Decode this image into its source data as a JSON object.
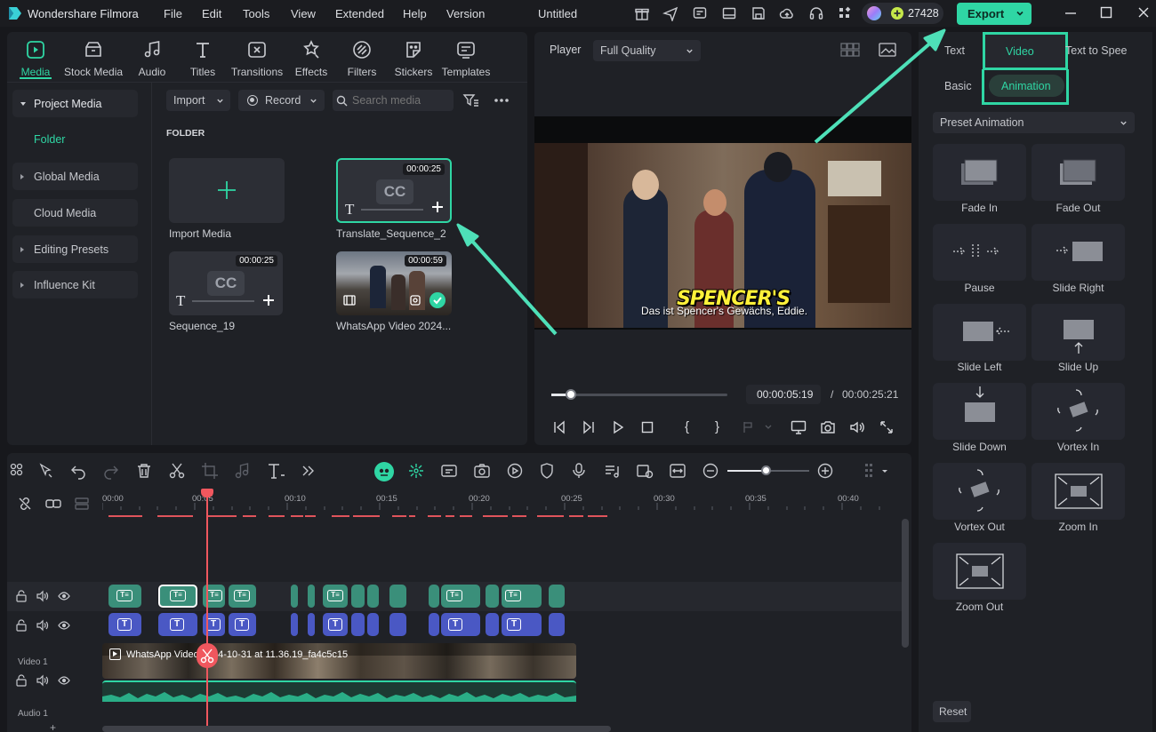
{
  "app": {
    "title": "Wondershare Filmora",
    "document": "Untitled",
    "credits": "27428",
    "export_label": "Export"
  },
  "menu": [
    "File",
    "Edit",
    "Tools",
    "View",
    "Extended",
    "Help",
    "Version"
  ],
  "top_nav": [
    {
      "label": "Media",
      "icon": "media-icon",
      "active": true
    },
    {
      "label": "Stock Media",
      "icon": "stock-media-icon"
    },
    {
      "label": "Audio",
      "icon": "audio-icon"
    },
    {
      "label": "Titles",
      "icon": "titles-icon"
    },
    {
      "label": "Transitions",
      "icon": "transitions-icon"
    },
    {
      "label": "Effects",
      "icon": "effects-icon"
    },
    {
      "label": "Filters",
      "icon": "filters-icon"
    },
    {
      "label": "Stickers",
      "icon": "stickers-icon"
    },
    {
      "label": "Templates",
      "icon": "templates-icon"
    }
  ],
  "sidebar": {
    "project_media": "Project Media",
    "folder": "Folder",
    "global_media": "Global Media",
    "cloud_media": "Cloud Media",
    "editing_presets": "Editing Presets",
    "influence_kit": "Influence Kit"
  },
  "media_toolbar": {
    "import": "Import",
    "record": "Record",
    "search_placeholder": "Search media"
  },
  "folder_heading": "FOLDER",
  "media_items": [
    {
      "label": "Import Media"
    },
    {
      "label": "Translate_Sequence_2",
      "duration": "00:00:25"
    },
    {
      "label": "Sequence_19",
      "duration": "00:00:25"
    },
    {
      "label": "WhatsApp Video 2024...",
      "duration": "00:00:59"
    }
  ],
  "player": {
    "label": "Player",
    "quality": "Full Quality",
    "subtitle_title": "SPENCER'S",
    "subtitle_line": "Das ist Spencer's Gewächs, Eddie.",
    "current_time": "00:00:05:19",
    "separator": "/",
    "total_time": "00:00:25:21",
    "progress": 0.11
  },
  "right_panel": {
    "tabs": [
      "Text",
      "Video",
      "Text to Spee"
    ],
    "active_tab": "Video",
    "subtabs": [
      "Basic",
      "Animation"
    ],
    "preset": "Preset Animation",
    "reset": "Reset",
    "animations": [
      "Fade In",
      "Fade Out",
      "Pause",
      "Slide Right",
      "Slide Left",
      "Slide Up",
      "Slide Down",
      "Vortex In",
      "Vortex Out",
      "Zoom In",
      "Zoom Out"
    ]
  },
  "timeline": {
    "ruler": [
      "00:00",
      "00:05",
      "00:10",
      "00:15",
      "00:20",
      "00:25",
      "00:30",
      "00:35",
      "00:40"
    ],
    "video_track_label": "Video 1",
    "audio_track_label": "Audio 1",
    "video_clip_label": "WhatsApp Video 2024-10-31 at 11.36.19_fa4c5c15"
  },
  "colors": {
    "accent": "#2fd6a4",
    "text_clip": "#3a8f7a",
    "title_clip": "#4a58c4",
    "playhead": "#f0575e"
  }
}
